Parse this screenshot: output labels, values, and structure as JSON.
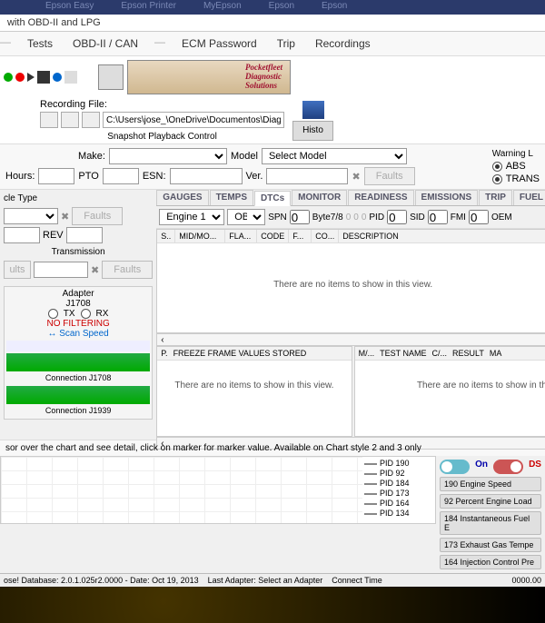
{
  "topshortcuts": [
    "Epson Easy",
    "Epson Printer",
    "MyEpson",
    "Epson",
    "Epson"
  ],
  "title": "with OBD-II and LPG",
  "menu": {
    "tests": "Tests",
    "obd": "OBD-II / CAN",
    "ecm": "ECM Password",
    "trip": "Trip",
    "rec": "Recordings"
  },
  "recording": {
    "label": "Recording File:",
    "path": "C:\\Users\\jose_\\OneDrive\\Documentos\\Diagnostics",
    "snapshot": "Snapshot Playback Control",
    "history": "Histo"
  },
  "header": {
    "make": "Make:",
    "model": "Model",
    "model_sel": "Select Model",
    "hours": "Hours:",
    "pto": "PTO",
    "esn": "ESN:",
    "ver": "Ver.",
    "faults": "Faults",
    "warning": "Warning L",
    "abs": "ABS",
    "trans": "TRANS"
  },
  "left": {
    "vehicle_type": "cle Type",
    "rev": "REV",
    "transmission": "Transmission",
    "faults": "Faults",
    "ults": "ults",
    "adapter": "Adapter",
    "j1708": "J1708",
    "tx": "TX",
    "rx": "RX",
    "nofilter": "NO FILTERING",
    "scan": "Scan Speed",
    "conn1": "Connection J1708",
    "conn2": "Connection J1939"
  },
  "tabs": {
    "gauges": "GAUGES",
    "temps": "TEMPS",
    "dtcs": "DTCs",
    "monitor": "MONITOR",
    "readiness": "READINESS",
    "emissions": "EMISSIONS",
    "trip": "TRIP",
    "fuel": "FUEL"
  },
  "dtc": {
    "engine": "Engine 1",
    "obd": "OBD",
    "spn": "SPN",
    "spn_v": "0",
    "byte": "Byte7/8",
    "byte_v": "0",
    "pid": "PID",
    "pid_v": "0",
    "sid": "SID",
    "sid_v": "0",
    "fmi": "FMI",
    "fmi_v": "0",
    "oem": "OEM"
  },
  "grid": {
    "cols": {
      "s": "S..",
      "mid": "MID/MO...",
      "fla": "FLA...",
      "code": "CODE",
      "f": "F...",
      "co": "CO...",
      "desc": "DESCRIPTION"
    },
    "noitems": "There are no items to show in this view.",
    "freeze": "FREEZE FRAME VALUES STORED",
    "p": "P.",
    "test": {
      "m": "M/...",
      "name": "TEST NAME",
      "c": "C/...",
      "res": "RESULT",
      "ma": "MA"
    }
  },
  "chartnote": "sor over the chart and see detail, click on marker for marker value. Available on Chart style 2 and 3 only",
  "legend": [
    "PID 190",
    "PID 92",
    "PID 184",
    "PID 173",
    "PID 164",
    "PID 134"
  ],
  "switches": {
    "on": "On",
    "ds": "DS"
  },
  "pidlist": [
    "190 Engine Speed",
    "92 Percent Engine Load",
    "184 Instantaneous Fuel E",
    "173 Exhaust Gas Tempe",
    "164 Injection Control Pre"
  ],
  "status": {
    "db": "ose! Database: 2.0.1.025r2.0000 - Date: Oct 19, 2013",
    "adapter": "Last Adapter: Select an Adapter",
    "conn": "Connect Time",
    "z": "0000.00"
  }
}
